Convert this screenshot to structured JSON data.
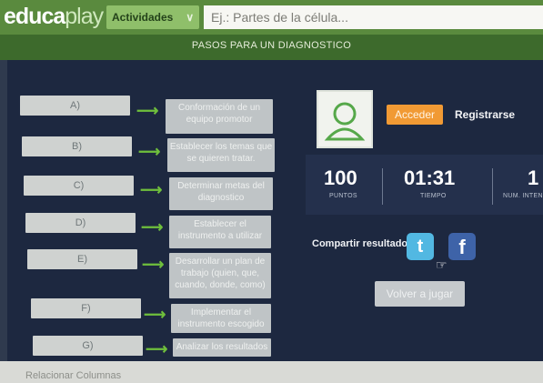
{
  "header": {
    "logo_bold": "educa",
    "logo_light": "play",
    "activities_label": "Actividades",
    "search_placeholder": "Ej.: Partes de la célula..."
  },
  "game": {
    "title": "PASOS PARA UN DIAGNOSTICO",
    "left_items": [
      "A)",
      "B)",
      "C)",
      "D)",
      "E)",
      "F)",
      "G)"
    ],
    "right_items": [
      "Conformación de un equipo promotor",
      "Establecer los temas que se quieren tratar.",
      "Determinar metas del diagnostico",
      "Establecer el instrumento a utilizar",
      "Desarrollar un plan de trabajo (quien, que, cuando, donde, como)",
      "Implementar el instrumento escogido",
      "Analizar los resultados"
    ]
  },
  "account": {
    "login_label": "Acceder",
    "register_label": "Registrarse"
  },
  "stats": {
    "points_value": "100",
    "points_label": "PUNTOS",
    "time_value": "01:31",
    "time_label": "TIEMPO",
    "attempts_value": "1",
    "attempts_label": "NUM. INTEN"
  },
  "share": {
    "label": "Compartir resultado:",
    "twitter_icon": "twitter-icon",
    "facebook_icon": "facebook-icon"
  },
  "replay_label": "Volver a jugar",
  "footer_label": "Relacionar Columnas",
  "colors": {
    "header_green": "#5a8a3e",
    "board_navy": "#1d2840",
    "login_orange": "#f19a34",
    "arrow_green": "#6fbf3c"
  }
}
